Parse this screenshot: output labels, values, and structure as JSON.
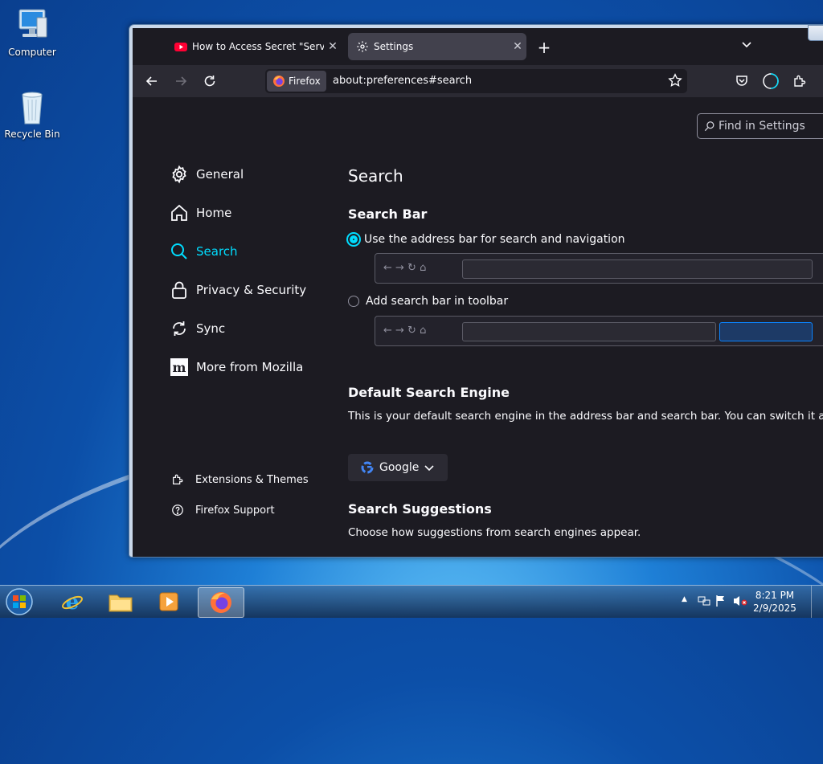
{
  "desktop": {
    "icons": [
      {
        "label": "Computer",
        "icon": "computer-icon"
      },
      {
        "label": "Recycle Bin",
        "icon": "recycle-bin-icon"
      }
    ]
  },
  "browser": {
    "tabs": [
      {
        "label": "How to Access Secret \"Service M",
        "icon": "youtube-icon",
        "active": false
      },
      {
        "label": "Settings",
        "icon": "gear-icon",
        "active": true
      }
    ],
    "identity_label": "Firefox",
    "url": "about:preferences#search"
  },
  "settings": {
    "find_placeholder": "Find in Settings",
    "categories": [
      {
        "label": "General",
        "icon": "gear-icon"
      },
      {
        "label": "Home",
        "icon": "home-icon"
      },
      {
        "label": "Search",
        "icon": "search-icon",
        "selected": true
      },
      {
        "label": "Privacy & Security",
        "icon": "lock-icon"
      },
      {
        "label": "Sync",
        "icon": "sync-icon"
      },
      {
        "label": "More from Mozilla",
        "icon": "mozilla-icon"
      }
    ],
    "footer_links": [
      {
        "label": "Extensions & Themes",
        "icon": "puzzle-icon"
      },
      {
        "label": "Firefox Support",
        "icon": "help-icon"
      }
    ],
    "page_title": "Search",
    "search_bar": {
      "heading": "Search Bar",
      "option_address": "Use the address bar for search and navigation",
      "option_toolbar": "Add search bar in toolbar",
      "selected": "address"
    },
    "default_engine": {
      "heading": "Default Search Engine",
      "description": "This is your default search engine in the address bar and search bar. You can switch it at an",
      "engine": "Google"
    },
    "suggestions": {
      "heading": "Search Suggestions",
      "description": "Choose how suggestions from search engines appear."
    }
  },
  "taskbar": {
    "clock_time": "8:21 PM",
    "clock_date": "2/9/2025"
  },
  "colors": {
    "accent": "#00ddff",
    "content_bg": "#1c1b22",
    "toolbar_bg": "#2b2a33"
  }
}
